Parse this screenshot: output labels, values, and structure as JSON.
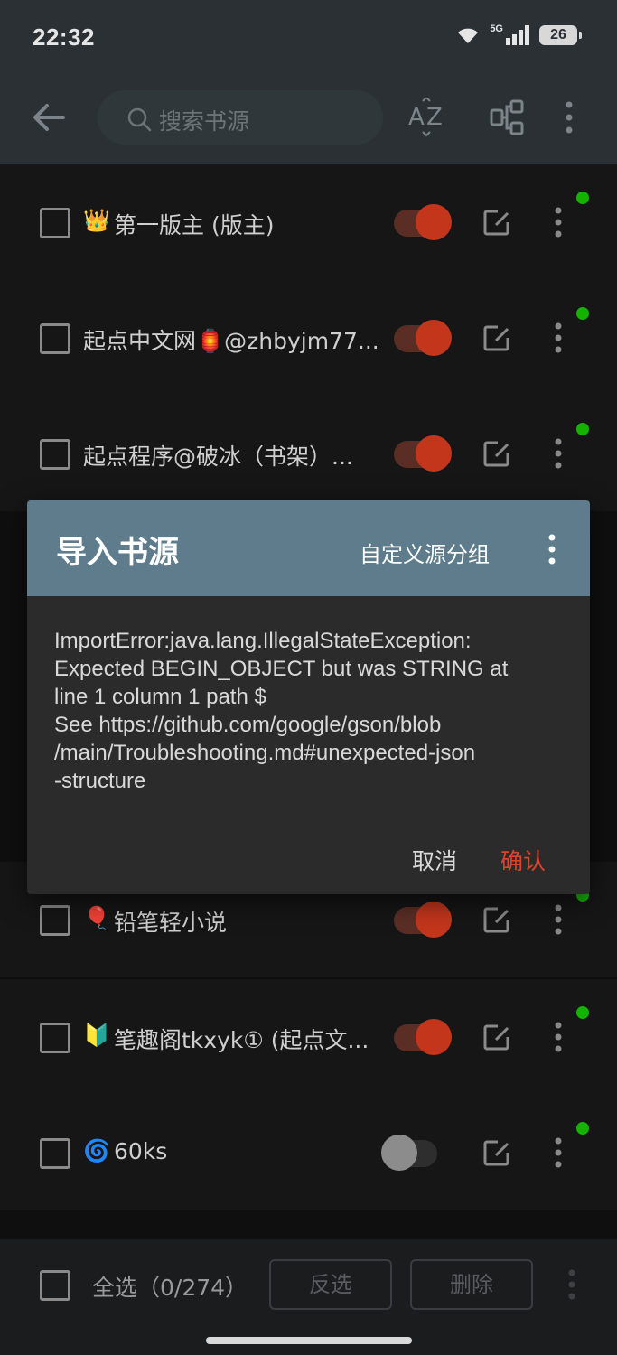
{
  "status_bar": {
    "time": "22:32",
    "network": "5G",
    "battery": "26"
  },
  "toolbar": {
    "search_placeholder": "搜索书源"
  },
  "sources": [
    {
      "prefix_icon": "crown-emoji",
      "prefix": "👑",
      "name": "第一版主 (版主)",
      "enabled": true
    },
    {
      "prefix_icon": "",
      "prefix": "",
      "name": "起点中文网🏮@zhbyjm77...",
      "enabled": true
    },
    {
      "prefix_icon": "",
      "prefix": "",
      "name": "起点程序@破冰（书架）...",
      "enabled": true
    },
    {
      "prefix_icon": "balloon-emoji",
      "prefix": "🎈",
      "name": "铅笔轻小说",
      "enabled": true
    },
    {
      "prefix_icon": "beginner-emoji",
      "prefix": "🔰",
      "name": "笔趣阁tkxyk① (起点文...",
      "enabled": true
    },
    {
      "prefix_icon": "cyclone-emoji",
      "prefix": "🌀",
      "name": "60ks",
      "enabled": false
    }
  ],
  "dialog": {
    "title": "导入书源",
    "custom_group": "自定义源分组",
    "message": "ImportError:java.lang.IllegalStateException:\nExpected BEGIN_OBJECT but was STRING at\nline 1 column 1 path $\nSee https://github.com/google/gson/blob\n/main/Troubleshooting.md#unexpected-json\n-structure",
    "cancel": "取消",
    "confirm": "确认"
  },
  "bottom_bar": {
    "select_all": "全选（0/274）",
    "invert": "反选",
    "delete": "删除"
  },
  "colors": {
    "accent": "#c3361c",
    "dialog_header": "#5e7c8b",
    "status_dot": "#13b300",
    "confirm": "#d9452a"
  }
}
